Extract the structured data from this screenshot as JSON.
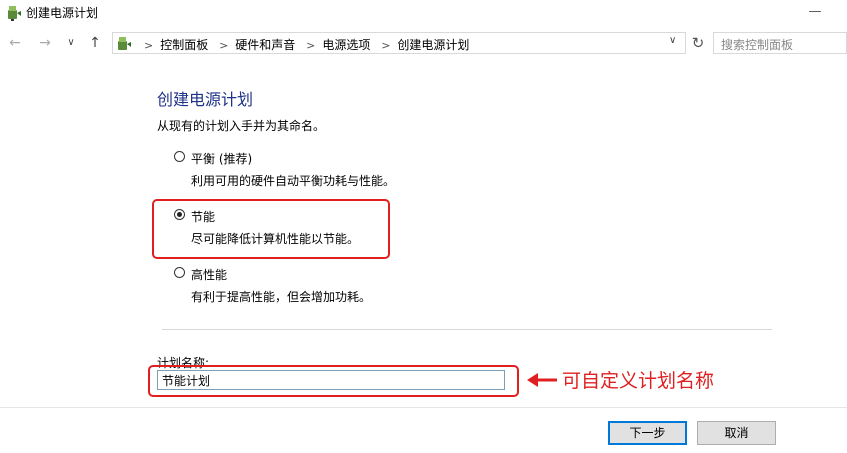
{
  "window": {
    "title": "创建电源计划",
    "minimize_glyph": "—"
  },
  "nav": {
    "back": "←",
    "forward": "→",
    "history": "∨",
    "up": "↑",
    "breadcrumbs": [
      "控制面板",
      "硬件和声音",
      "电源选项",
      "创建电源计划"
    ],
    "dropdown": "∨",
    "refresh": "↻",
    "search_placeholder": "搜索控制面板"
  },
  "content": {
    "title": "创建电源计划",
    "subtitle": "从现有的计划入手并为其命名。",
    "options": [
      {
        "label": "平衡 (推荐)",
        "description": "利用可用的硬件自动平衡功耗与性能。",
        "selected": false
      },
      {
        "label": "节能",
        "description": "尽可能降低计算机性能以节能。",
        "selected": true
      },
      {
        "label": "高性能",
        "description": "有利于提高性能，但会增加功耗。",
        "selected": false
      }
    ],
    "plan_name_label": "计划名称:",
    "plan_name_value": "节能计划"
  },
  "annotation": {
    "text": "可自定义计划名称",
    "color": "#e02020"
  },
  "buttons": {
    "next": "下一步",
    "cancel": "取消"
  },
  "colors": {
    "title": "#1e3287",
    "highlight": "#e02020",
    "button_focus": "#0078d7"
  }
}
